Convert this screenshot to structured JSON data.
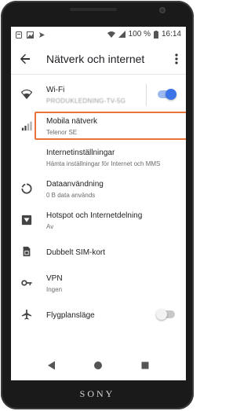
{
  "status_bar": {
    "battery": "100 %",
    "time": "16:14",
    "icons": [
      "notification-icon",
      "image-icon",
      "send-icon",
      "wifi-icon",
      "signal-icon",
      "battery-icon"
    ]
  },
  "app_bar": {
    "title": "Nätverk och internet",
    "back_icon": "arrow-left-icon",
    "more_icon": "more-vert-icon"
  },
  "items": [
    {
      "icon": "wifi-icon",
      "title": "Wi-Fi",
      "subtitle": "PRODUKLEDNING-TV-5G",
      "toggle": "on"
    },
    {
      "icon": "cellular-signal-icon",
      "title": "Mobila nätverk",
      "subtitle": "Telenor SE",
      "highlighted": true
    },
    {
      "icon": "",
      "title": "Internetinställningar",
      "subtitle": "Hämta inställningar för Internet och MMS"
    },
    {
      "icon": "data-usage-icon",
      "title": "Dataanvändning",
      "subtitle": "0 B data används"
    },
    {
      "icon": "hotspot-icon",
      "title": "Hotspot och Internetdelning",
      "subtitle": "Av"
    },
    {
      "icon": "sim-card-icon",
      "title": "Dubbelt SIM-kort",
      "subtitle": ""
    },
    {
      "icon": "vpn-key-icon",
      "title": "VPN",
      "subtitle": "Ingen"
    },
    {
      "icon": "airplane-icon",
      "title": "Flygplansläge",
      "subtitle": "",
      "toggle": "off"
    }
  ],
  "nav": [
    "back-triangle-icon",
    "home-circle-icon",
    "recents-square-icon"
  ],
  "brand": "SONY",
  "colors": {
    "accent": "#3a74e8",
    "highlight": "#e8743b"
  }
}
